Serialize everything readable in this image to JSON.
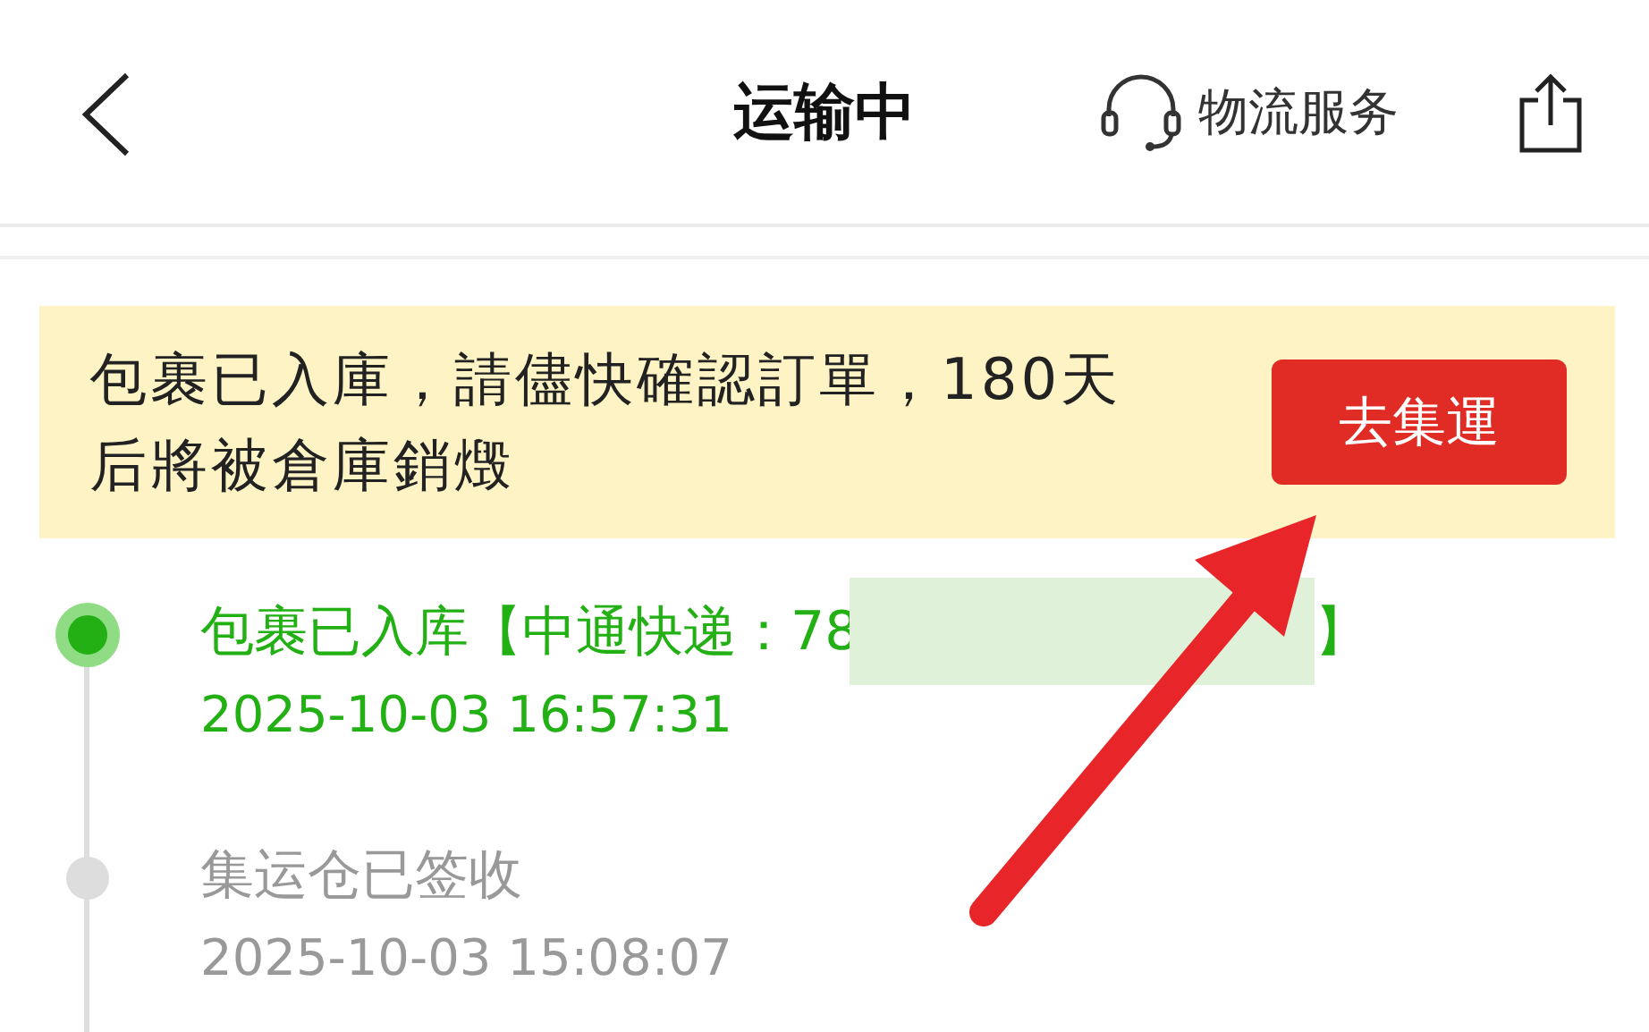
{
  "header": {
    "title": "运输中",
    "service_label": "物流服务"
  },
  "notice": {
    "text": "包裹已入庫，請儘快確認訂單，180天后將被倉庫銷燬",
    "button": "去集運"
  },
  "tracking": [
    {
      "title": "包裹已入库【中通快递：78",
      "redacted": true,
      "title_end": "】",
      "time": "2025-10-03 16:57:31",
      "current": true
    },
    {
      "title": "集运仓已签收",
      "redacted": false,
      "time": "2025-10-03 15:08:07",
      "current": false
    }
  ]
}
